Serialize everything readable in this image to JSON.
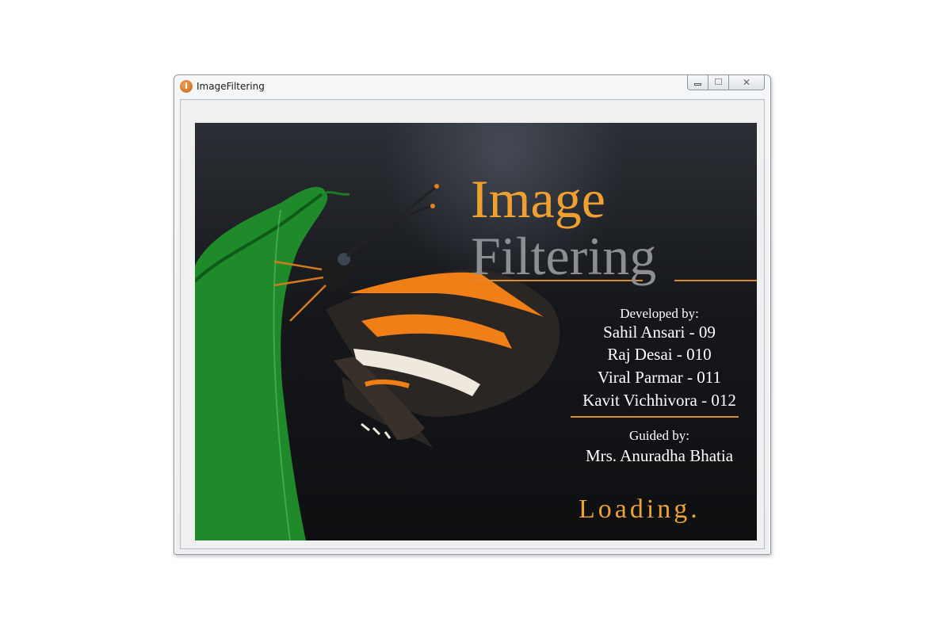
{
  "window": {
    "title": "ImageFiltering",
    "icon": "app-icon",
    "buttons": {
      "minimize": "minimize-icon",
      "maximize": "maximize-icon",
      "close": "close-icon"
    }
  },
  "splash": {
    "title_line1": "Image",
    "title_line2": "Filtering",
    "developed_by_label": "Developed by:",
    "developers": [
      "Sahil Ansari - 09",
      "Raj Desai - 010",
      "Viral Parmar - 011",
      "Kavit Vichhivora - 012"
    ],
    "guided_by_label": "Guided by:",
    "guide": "Mrs. Anuradha Bhatia",
    "status": "Loading.",
    "colors": {
      "accent": "#f0a030",
      "title_gray": "#8c8e92",
      "background": "#111214"
    }
  }
}
